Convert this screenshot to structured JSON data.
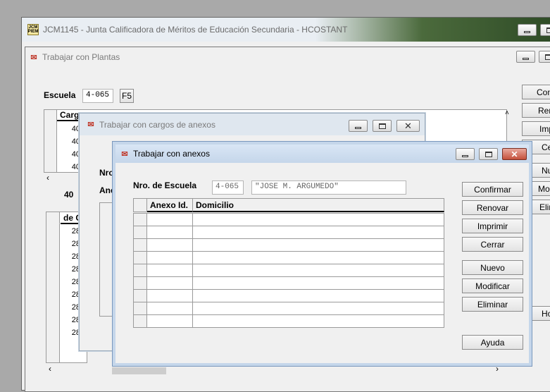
{
  "main_window": {
    "title": "JCM1145 - Junta Calificadora de Méritos de Educación Secundaria - HCOSTANT",
    "icon_text": "JCM\nPIEM"
  },
  "plantas_window": {
    "title": "Trabajar con Plantas",
    "escuela_label": "Escuela",
    "escuela_value": "4-065",
    "f5_label": "F5",
    "grid_headers": [
      "Cargo",
      "de C"
    ],
    "cargo_values": [
      "40",
      "40",
      "40",
      "40"
    ],
    "cargo_label_40": "40",
    "de_c_values": [
      "28",
      "28",
      "28",
      "28",
      "28",
      "28",
      "28",
      "28",
      "28"
    ],
    "right_buttons": [
      "Con",
      "Ren",
      "Imp",
      "Ce",
      "Nu",
      "Moc",
      "Elin",
      "Ho"
    ]
  },
  "cargos_window": {
    "title": "Trabajar con cargos de anexos",
    "labels": [
      "Nro",
      "Ane"
    ]
  },
  "anexos_window": {
    "title": "Trabajar con anexos",
    "nro_escuela_label": "Nro. de Escuela",
    "nro_escuela_value": "4-065",
    "escuela_nombre_value": "\"JOSE M. ARGUMEDO\"",
    "columns": [
      "Anexo Id.",
      "Domicilio"
    ],
    "rows": 9,
    "buttons": {
      "confirmar": "Confirmar",
      "renovar": "Renovar",
      "imprimir": "Imprimir",
      "cerrar": "Cerrar",
      "nuevo": "Nuevo",
      "modificar": "Modificar",
      "eliminar": "Eliminar",
      "ayuda": "Ayuda"
    }
  },
  "icons": {
    "app": "jcm-app-icon",
    "form": "oracle-form-icon",
    "minimize": "minimize-icon",
    "maximize": "maximize-icon",
    "close": "close-icon"
  }
}
